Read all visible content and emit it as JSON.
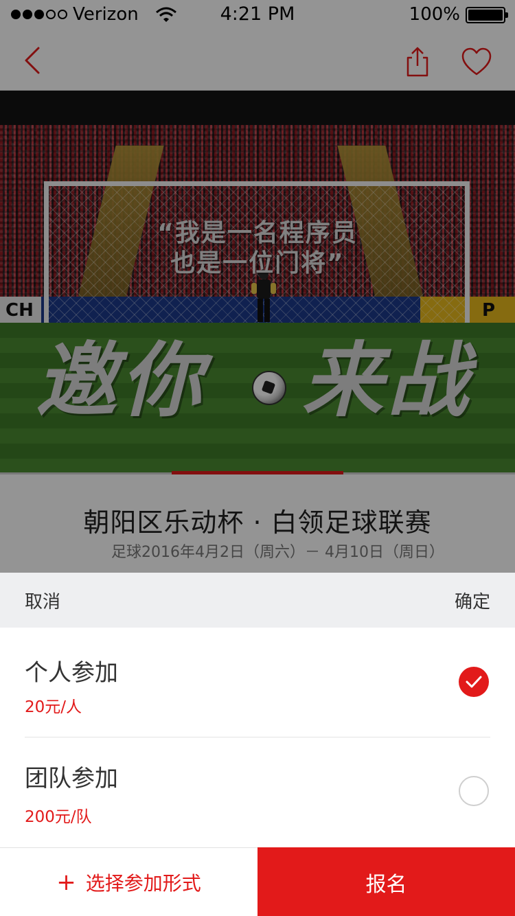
{
  "status_bar": {
    "carrier": "Verizon",
    "time": "4:21 PM",
    "battery": "100%",
    "signal_bars": 3,
    "signal_total": 5
  },
  "nav": {
    "back_icon": "chevron-left-icon",
    "share_icon": "share-icon",
    "favorite_icon": "heart-icon",
    "accent_color": "#e21a1a"
  },
  "banner": {
    "tagline_line1": "“我是一名程序员",
    "tagline_line2": "也是一位门将”",
    "headline_left": "邀你",
    "headline_right": "来战",
    "board_left_text": "CH",
    "board_right_text": "P",
    "active_slide": 2,
    "slide_count": 3
  },
  "event": {
    "title": "朝阳区乐动杯 · 白领足球联赛",
    "subtitle": "足球2016年4月2日（周六）－ 4月10日（周日）"
  },
  "sheet": {
    "cancel_label": "取消",
    "confirm_label": "确定",
    "options": [
      {
        "label": "个人参加",
        "price": "20元/人",
        "selected": true
      },
      {
        "label": "团队参加",
        "price": "200元/队",
        "selected": false
      }
    ]
  },
  "footer": {
    "select_label": "选择参加形式",
    "select_icon": "plus-icon",
    "signup_label": "报名",
    "brand_color": "#e21a1a"
  }
}
